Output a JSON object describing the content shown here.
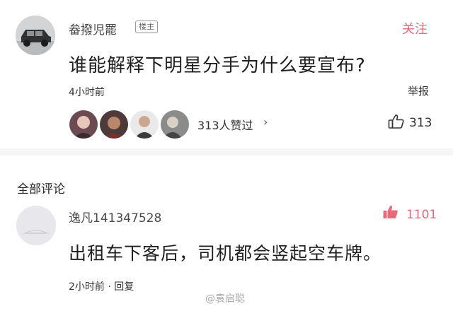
{
  "post": {
    "username": "畚撥児罷",
    "op_badge": "楼主",
    "follow_label": "关注",
    "question": "谁能解释下明星分手为什么要宣布?",
    "time_ago": "4小时前",
    "report_label": "举报",
    "likes_text": "313人赞过",
    "like_count": "313"
  },
  "comments": {
    "section_title": "全部评论",
    "items": [
      {
        "username": "逸凡141347528",
        "like_count": "1101",
        "text": "出租车下客后，司机都会竖起空车牌。",
        "time_ago": "2小时前",
        "reply_label": "回复"
      }
    ]
  },
  "watermark": "@袁启聪",
  "colors": {
    "accent": "#e9687c",
    "text": "#1f1f1f"
  }
}
